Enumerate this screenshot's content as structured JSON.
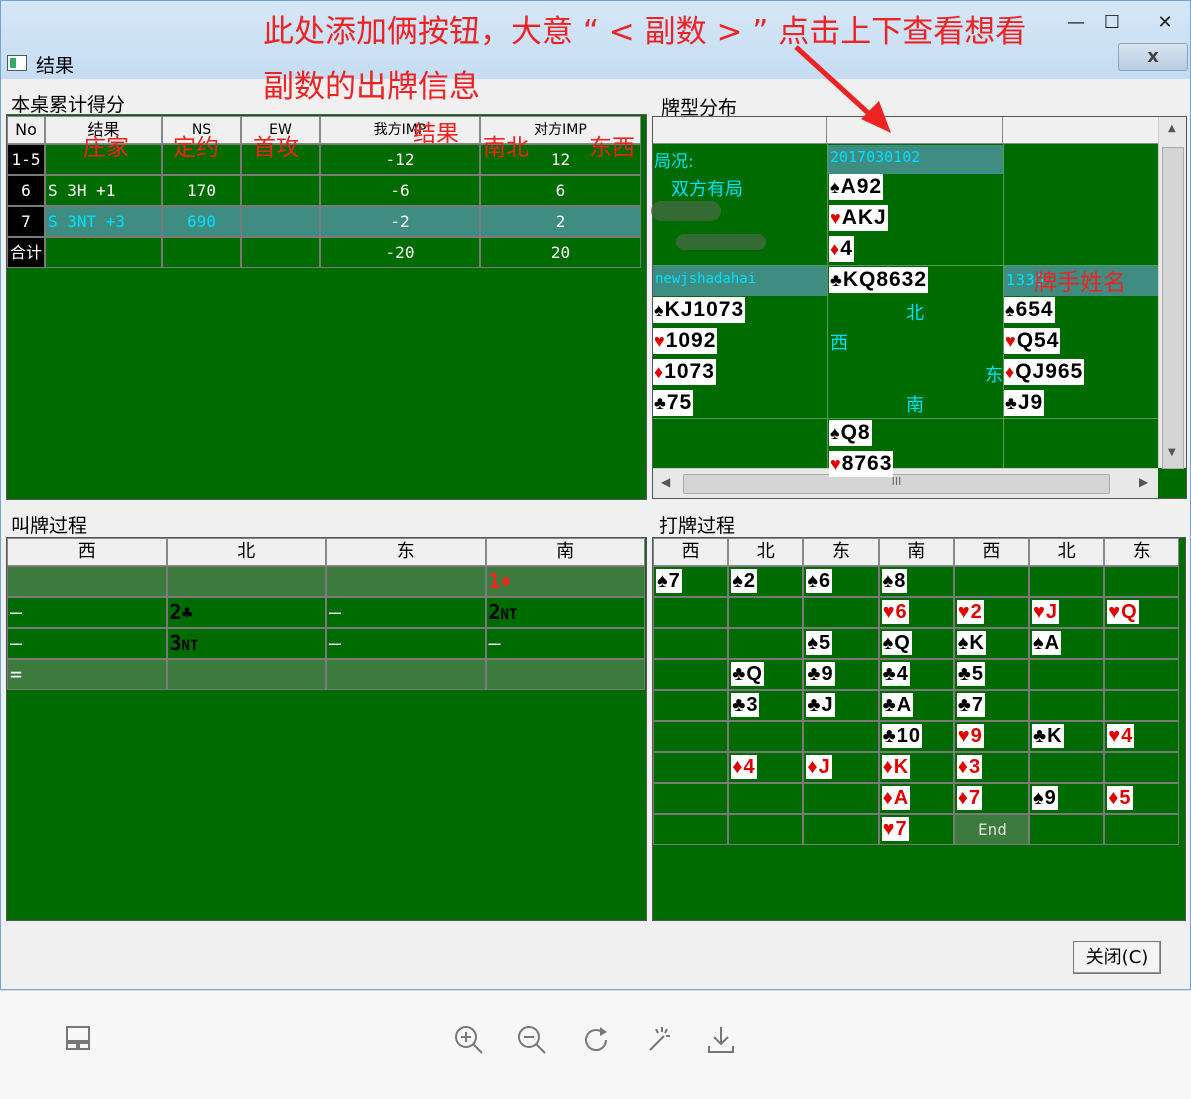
{
  "window": {
    "title": "结果",
    "annotation_line1": "此处添加俩按钮，大意 “ < 副数 > ” 点击上下查看想看",
    "annotation_line2": "副数的出牌信息",
    "minimize": "—",
    "maximize": "☐",
    "close": "✕",
    "close_small": "x"
  },
  "score_panel": {
    "title": "本桌累计得分",
    "headers": [
      "No",
      "结果",
      "NS",
      "EW",
      "我方IMP",
      "对方IMP"
    ],
    "annotations": [
      "庄家",
      "定约",
      "首攻",
      "结果",
      "南北",
      "东西"
    ],
    "rows": [
      {
        "no": "1-5",
        "result": "",
        "ns": "",
        "ew": "",
        "mine": "-12",
        "theirs": "12"
      },
      {
        "no": "6",
        "result": "S 3H +1",
        "ns": "170",
        "ew": "",
        "mine": "-6",
        "theirs": "6"
      },
      {
        "no": "7",
        "result": "S 3NT +3",
        "ns": "690",
        "ew": "",
        "mine": "-2",
        "theirs": "2"
      },
      {
        "no": "合计",
        "result": "",
        "ns": "",
        "ew": "",
        "mine": "-20",
        "theirs": "20"
      }
    ]
  },
  "distribution_panel": {
    "title": "牌型分布",
    "situation_label": "局况:",
    "situation_value": "双方有局",
    "board_id": "2017030102",
    "west_player": "newjshadahai",
    "east_player": "1330",
    "player_annotation": "牌手姓名",
    "dir_north": "北",
    "dir_west": "西",
    "dir_east": "东",
    "dir_south": "南",
    "north": {
      "spades": "A92",
      "hearts": "AKJ",
      "diamonds": "4",
      "clubs": "KQ8632"
    },
    "west": {
      "spades": "KJ1073",
      "hearts": "1092",
      "diamonds": "1073",
      "clubs": "75"
    },
    "east": {
      "spades": "654",
      "hearts": "Q54",
      "diamonds": "QJ965",
      "clubs": "J9"
    },
    "south": {
      "spades": "Q8",
      "hearts": "8763"
    },
    "scroll_grip": "III"
  },
  "bidding_panel": {
    "title": "叫牌过程",
    "headers": [
      "西",
      "北",
      "东",
      "南"
    ],
    "rows": [
      [
        "",
        "",
        "",
        "1♦"
      ],
      [
        "—",
        "2♣",
        "—",
        "2NT"
      ],
      [
        "—",
        "3NT",
        "—",
        "—"
      ],
      [
        "=",
        "",
        "",
        ""
      ]
    ]
  },
  "play_panel": {
    "title": "打牌过程",
    "headers": [
      "西",
      "北",
      "东",
      "南",
      "西",
      "北",
      "东"
    ],
    "rows": [
      [
        "♠7",
        "♠2",
        "♠6",
        "♠8",
        "",
        "",
        ""
      ],
      [
        "",
        "",
        "",
        "♥6",
        "♥2",
        "♥J",
        "♥Q"
      ],
      [
        "",
        "",
        "♠5",
        "♠Q",
        "♠K",
        "♠A",
        ""
      ],
      [
        "",
        "♣Q",
        "♣9",
        "♣4",
        "♣5",
        "",
        ""
      ],
      [
        "",
        "♣3",
        "♣J",
        "♣A",
        "♣7",
        "",
        ""
      ],
      [
        "",
        "",
        "",
        "♣10",
        "♥9",
        "♣K",
        "♥4"
      ],
      [
        "",
        "♦4",
        "♦J",
        "♦K",
        "♦3",
        "",
        ""
      ],
      [
        "",
        "",
        "",
        "♦A",
        "♦7",
        "♠9",
        "♦5"
      ],
      [
        "",
        "",
        "",
        "♥7",
        "End",
        "",
        ""
      ]
    ]
  },
  "footer": {
    "close_button": "关闭(C)"
  },
  "viewer_toolbar": {
    "icons": [
      "layout-icon",
      "zoom-in-icon",
      "zoom-out-icon",
      "rotate-icon",
      "magic-wand-icon",
      "download-icon"
    ]
  }
}
